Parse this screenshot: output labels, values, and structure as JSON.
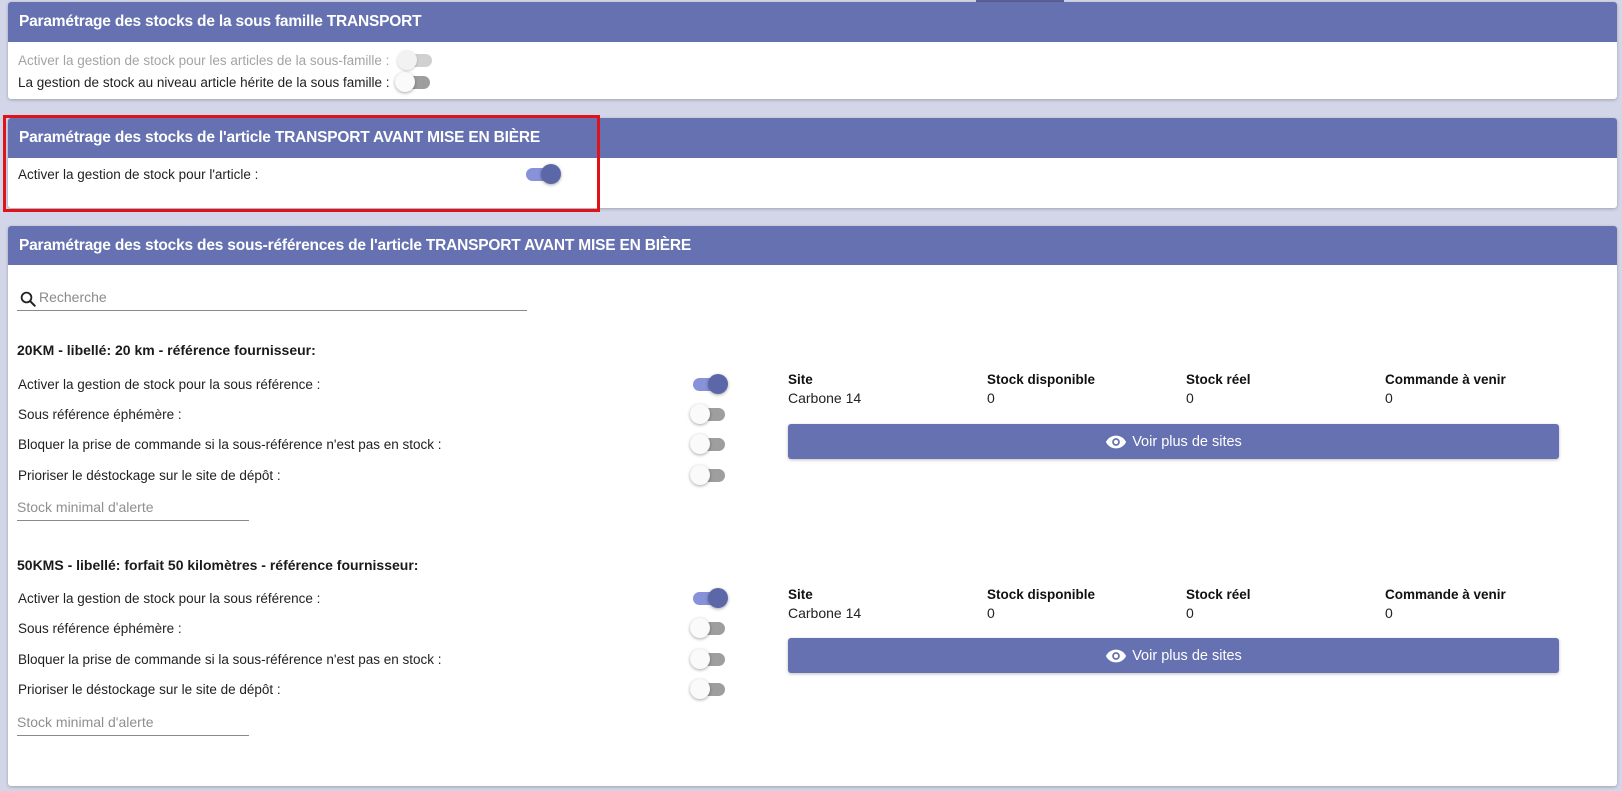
{
  "family_section": {
    "title": "Paramétrage des stocks de la sous famille TRANSPORT",
    "activate_label": "Activer la gestion de stock pour les articles de la sous-famille :",
    "inherit_label": "La gestion de stock au niveau article hérite de la sous famille :",
    "activate_on": false,
    "inherit_on": false
  },
  "article_section": {
    "title": "Paramétrage des stocks de l'article TRANSPORT AVANT MISE EN BIÈRE",
    "activate_label": "Activer la gestion de stock pour l'article :",
    "activate_on": true
  },
  "subref_section": {
    "title": "Paramétrage des stocks des sous-références de l'article TRANSPORT AVANT MISE EN BIÈRE",
    "search_placeholder": "Recherche",
    "table_headers": [
      "Site",
      "Stock disponible",
      "Stock réel",
      "Commande à venir"
    ],
    "option_labels": {
      "activate": "Activer la gestion de stock pour la sous référence :",
      "ephemeral": "Sous référence éphémère :",
      "block": "Bloquer la prise de commande si la sous-référence n'est pas en stock :",
      "prioritize": "Prioriser le déstockage sur le site de dépôt :"
    },
    "alert_placeholder": "Stock minimal d'alerte",
    "more_sites_label": "Voir plus de sites",
    "subrefs": [
      {
        "title": "20KM - libellé: 20 km - référence fournisseur:",
        "activate_on": true,
        "ephemeral_on": false,
        "block_on": false,
        "prioritize_on": false,
        "row": [
          "Carbone 14",
          "0",
          "0",
          "0"
        ]
      },
      {
        "title": "50KMS - libellé: forfait 50 kilomètres - référence fournisseur:",
        "activate_on": true,
        "ephemeral_on": false,
        "block_on": false,
        "prioritize_on": false,
        "row": [
          "Carbone 14",
          "0",
          "0",
          "0"
        ]
      }
    ]
  },
  "colors": {
    "header_bg": "#6571b0",
    "toggle_on": "#5c67a8",
    "highlight": "#e0131a"
  }
}
